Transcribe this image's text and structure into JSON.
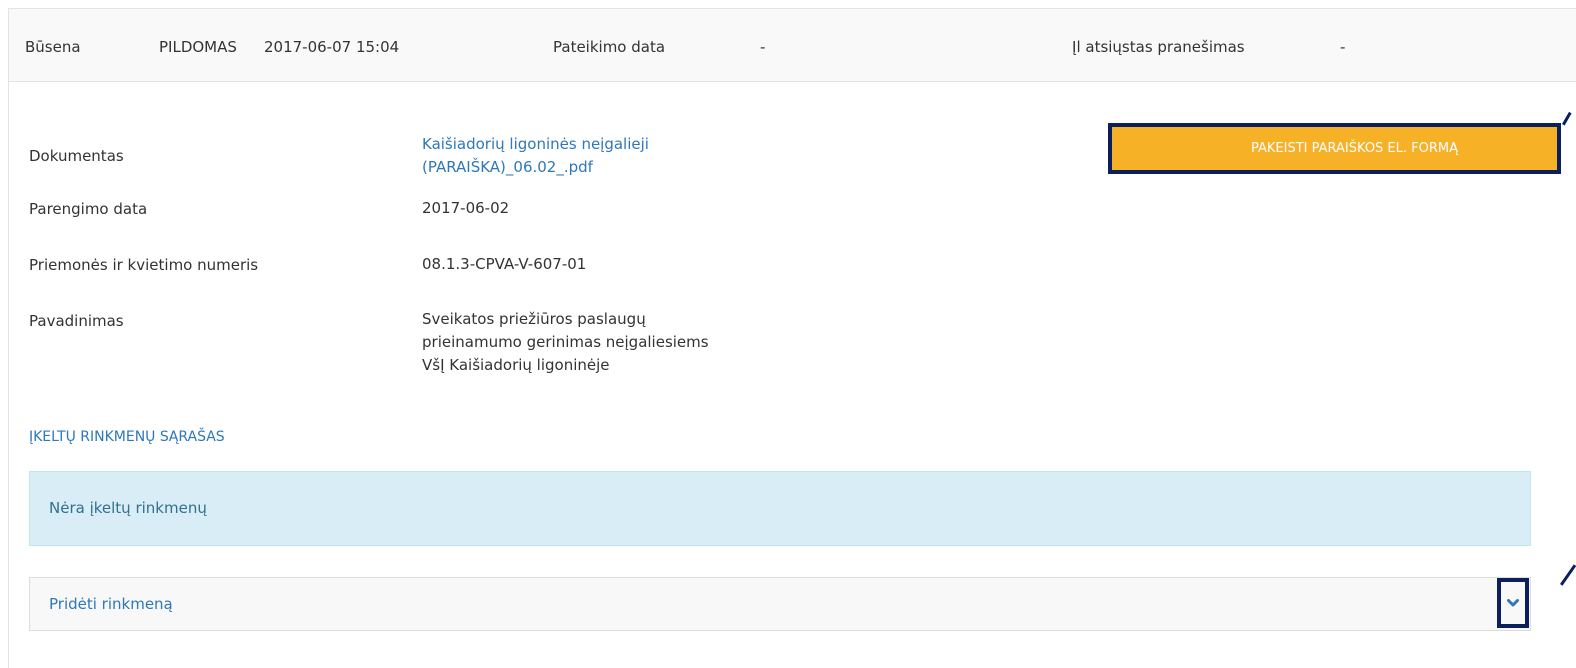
{
  "status_bar": {
    "status_label": "Būsena",
    "status_value": "PILDOMAS",
    "status_datetime": "2017-06-07 15:04",
    "submission_label": "Pateikimo data",
    "submission_value": "-",
    "notification_label": "Į",
    "notification_label_rest": "l atsiųstas pranešimas",
    "notification_value": "-"
  },
  "document": {
    "document_label": "Dokumentas",
    "document_link_line1": "Kaišiadorių ligoninės neįgalieji",
    "document_link_line2": "(PARAIŠKA)_06.02_.pdf",
    "prepared_label": "Parengimo data",
    "prepared_value": "2017-06-02",
    "measure_label": "Priemonės ir kvietimo numeris",
    "measure_value": "08.1.3-CPVA-V-607-01",
    "title_label": "Pavadinimas",
    "title_line1": "Sveikatos priežiūros paslaugų",
    "title_line2": "prieinamumo gerinimas neįgaliesiems",
    "title_line3": "VšĮ Kaišiadorių ligoninėje"
  },
  "actions": {
    "change_form_button": "PAKEISTI PARAIŠKOS EL. FORMĄ"
  },
  "files": {
    "list_title": "ĮKELTŲ RINKMENŲ SĄRAŠAS",
    "empty_message": "Nėra įkeltų rinkmenų",
    "add_file_label": "Pridėti rinkmeną"
  },
  "icons": {
    "expand": "chevron-down-icon"
  },
  "colors": {
    "accent_button": "#f7b126",
    "link": "#2e78b9",
    "info_bg": "#d9edf7",
    "highlight_border": "#0a1f5c"
  }
}
